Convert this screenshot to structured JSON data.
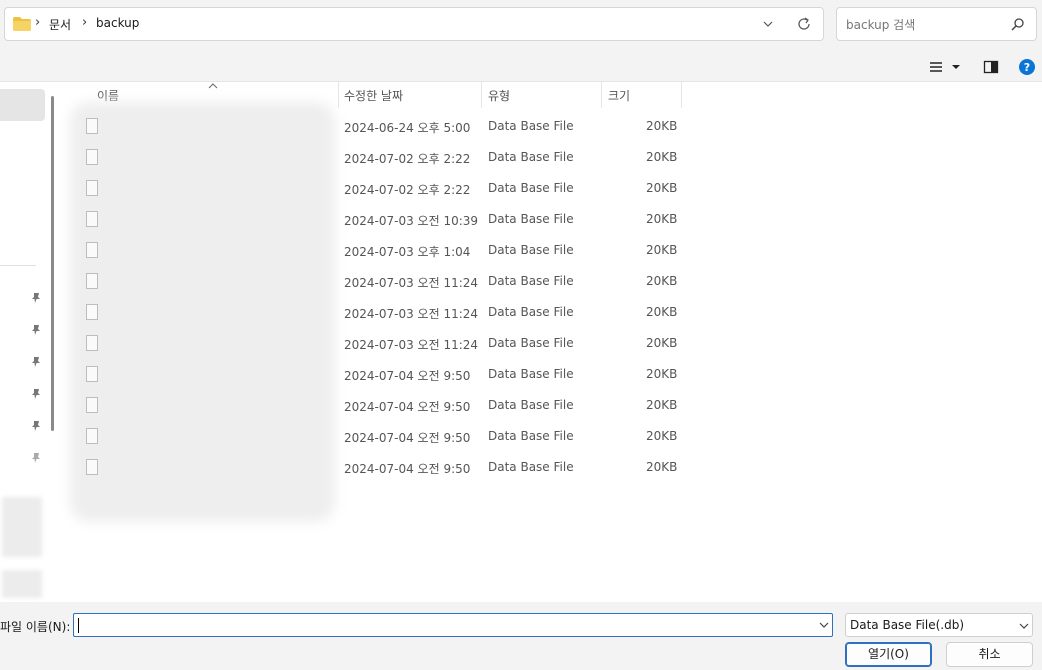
{
  "breadcrumb": {
    "part1": "문서",
    "part2": "backup"
  },
  "search": {
    "placeholder": "backup 검색"
  },
  "columns": {
    "name": "이름",
    "modified": "수정한 날짜",
    "type": "유형",
    "size": "크기"
  },
  "files": [
    {
      "date": "2024-06-24 오후 5:00",
      "type": "Data Base File",
      "size": "20KB"
    },
    {
      "date": "2024-07-02 오후 2:22",
      "type": "Data Base File",
      "size": "20KB"
    },
    {
      "date": "2024-07-02 오후 2:22",
      "type": "Data Base File",
      "size": "20KB"
    },
    {
      "date": "2024-07-03 오전 10:39",
      "type": "Data Base File",
      "size": "20KB"
    },
    {
      "date": "2024-07-03 오후 1:04",
      "type": "Data Base File",
      "size": "20KB"
    },
    {
      "date": "2024-07-03 오전 11:24",
      "type": "Data Base File",
      "size": "20KB"
    },
    {
      "date": "2024-07-03 오전 11:24",
      "type": "Data Base File",
      "size": "20KB"
    },
    {
      "date": "2024-07-03 오전 11:24",
      "type": "Data Base File",
      "size": "20KB"
    },
    {
      "date": "2024-07-04 오전 9:50",
      "type": "Data Base File",
      "size": "20KB"
    },
    {
      "date": "2024-07-04 오전 9:50",
      "type": "Data Base File",
      "size": "20KB"
    },
    {
      "date": "2024-07-04 오전 9:50",
      "type": "Data Base File",
      "size": "20KB"
    },
    {
      "date": "2024-07-04 오전 9:50",
      "type": "Data Base File",
      "size": "20KB"
    }
  ],
  "bottom": {
    "filename_label": "파일 이름(N):",
    "filename_value": "",
    "file_type": "Data Base File(.db)",
    "open_label": "열기(O)",
    "cancel_label": "취소"
  },
  "icons": {
    "folder": "folder-icon",
    "chevron": "chevron-right-icon",
    "refresh": "refresh-icon",
    "search": "search-icon",
    "view": "list-view-icon",
    "preview": "preview-pane-icon",
    "help": "help-icon",
    "pin": "pin-icon",
    "file": "file-icon"
  },
  "colors": {
    "accent": "#2f6fbf",
    "help": "#0a74d8",
    "folder": "#f0c040"
  }
}
